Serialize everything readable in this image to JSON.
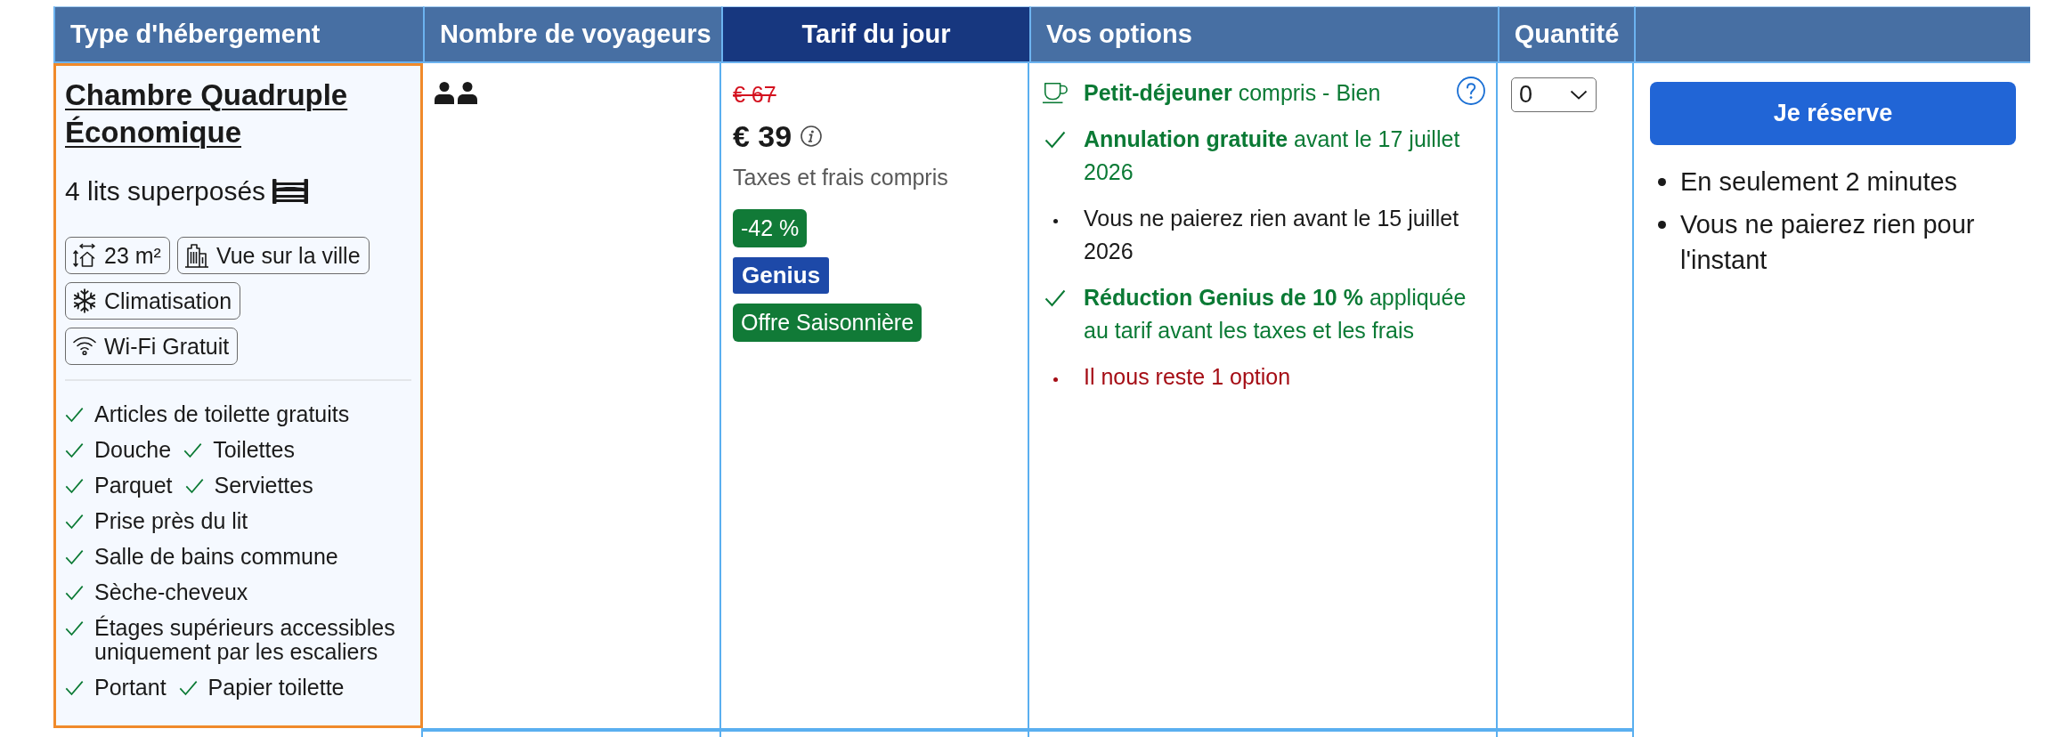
{
  "table": {
    "columns": [
      {
        "label": "Type d'hébergement",
        "highlighted": false
      },
      {
        "label": "Nombre de voyageurs",
        "highlighted": false
      },
      {
        "label": "Tarif du jour",
        "highlighted": true
      },
      {
        "label": "Vos options",
        "highlighted": false
      },
      {
        "label": "Quantité",
        "highlighted": false
      }
    ],
    "rows": [
      {
        "room": {
          "name": "Chambre Quadruple Économique",
          "highlighted": true,
          "beds": "4 lits superposés",
          "facilities": [
            {
              "kind": "size",
              "label": "23 m²"
            },
            {
              "kind": "view",
              "label": "Vue sur la ville"
            },
            {
              "kind": "air_conditioning",
              "label": "Climatisation"
            },
            {
              "kind": "wifi",
              "label": "Wi-Fi Gratuit"
            }
          ],
          "amenities": [
            "Articles de toilette gratuits",
            "Douche",
            "Toilettes",
            "Parquet",
            "Serviettes",
            "Prise près du lit",
            "Salle de bains commune",
            "Sèche-cheveux",
            "Étages supérieurs accessibles uniquement par les escaliers",
            "Portant",
            "Papier toilette"
          ]
        },
        "guests": [
          {
            "kind": "adult"
          },
          {
            "kind": "adult"
          }
        ],
        "price": {
          "original": "€ 67",
          "current": "€ 39",
          "note": "Taxes et frais compris",
          "badges": [
            {
              "kind": "discount",
              "label": "-42 %"
            },
            {
              "kind": "genius",
              "label": "Genius"
            },
            {
              "kind": "deal",
              "label": "Offre Saisonnière"
            }
          ]
        },
        "options": [
          {
            "kind": "meal",
            "text": "**Petit-déjeuner** compris - Bien",
            "help": true
          },
          {
            "kind": "included",
            "text": "**Annulation gratuite** avant le 17 juillet 2026"
          },
          {
            "kind": "note",
            "text": "Vous ne paierez rien avant le 15 juillet 2026"
          },
          {
            "kind": "included",
            "text": "**Réduction Genius de 10 %** appliquée au tarif avant les taxes et les frais"
          },
          {
            "kind": "urgency",
            "text": "Il nous reste 1 option"
          }
        ],
        "quantity": {
          "value": "0"
        },
        "booking": {
          "button": "Je réserve",
          "perks": [
            "En seulement 2 minutes",
            "Vous ne paierez rien pour l'instant"
          ]
        }
      }
    ]
  }
}
